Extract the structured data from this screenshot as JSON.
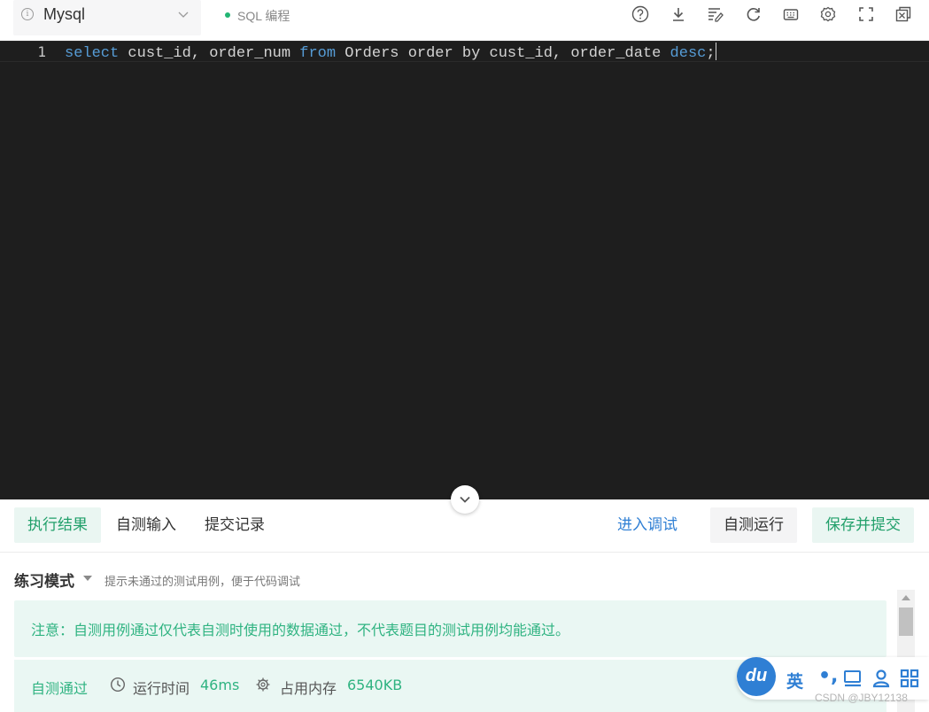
{
  "toolbar": {
    "language": "Mysql",
    "mode_label": "SQL 编程",
    "icons": [
      "help-icon",
      "download-icon",
      "format-code-icon",
      "refresh-icon",
      "keyboard-icon",
      "settings-icon",
      "fullscreen-icon",
      "float-window-icon"
    ]
  },
  "editor": {
    "line_number": "1",
    "code_tokens": [
      {
        "text": "select",
        "kw": true
      },
      {
        "text": " cust_id, order_num ",
        "kw": false
      },
      {
        "text": "from",
        "kw": true
      },
      {
        "text": " Orders order by cust_id, order_date ",
        "kw": false
      },
      {
        "text": "desc",
        "kw": true
      },
      {
        "text": ";",
        "kw": false
      }
    ]
  },
  "tabs": {
    "result": "执行结果",
    "self_input": "自测输入",
    "records": "提交记录"
  },
  "actions": {
    "debug": "进入调试",
    "run": "自测运行",
    "submit": "保存并提交"
  },
  "result": {
    "mode_title": "练习模式",
    "mode_hint": "提示未通过的测试用例，便于代码调试",
    "notice": "注意：自测用例通过仅代表自测时使用的数据通过，不代表题目的测试用例均能通过。",
    "status": "自测通过",
    "time_label": "运行时间",
    "time_value": "46ms",
    "mem_label": "占用内存",
    "mem_value": "6540KB"
  },
  "ime": {
    "logo": "du",
    "lang": "英",
    "punct": "•,"
  },
  "watermark": "CSDN @JBY12138",
  "colors": {
    "accent_green": "#22a06b",
    "link_blue": "#2f7fd4",
    "editor_bg": "#1e1e1e",
    "keyword": "#569cd6"
  }
}
